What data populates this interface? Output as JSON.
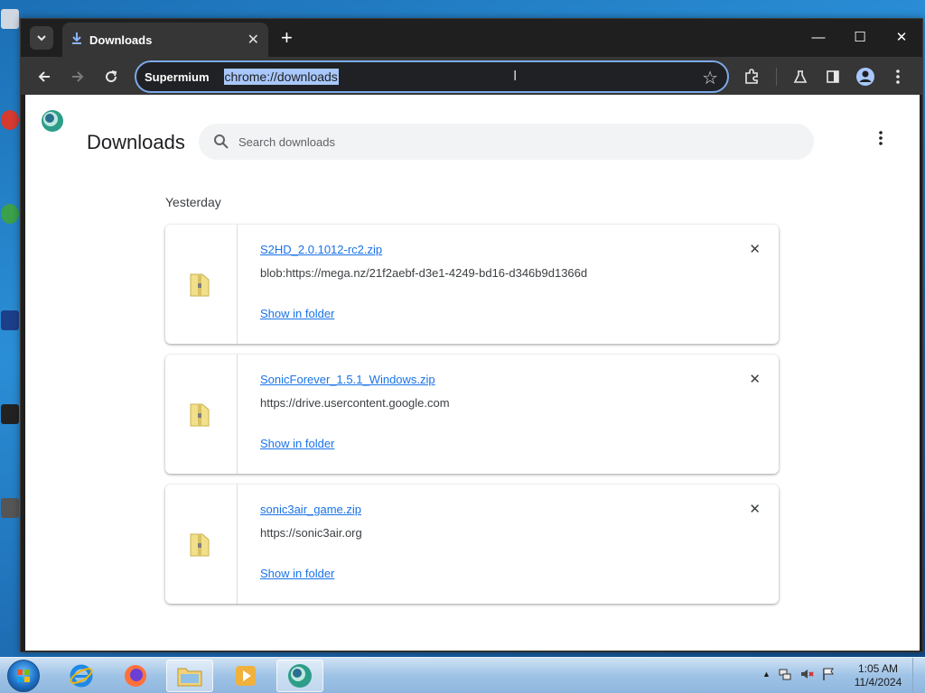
{
  "browser": {
    "tab": {
      "title": "Downloads"
    },
    "omnibox": {
      "brand": "Supermium",
      "url": "chrome://downloads"
    }
  },
  "page": {
    "title": "Downloads",
    "search": {
      "placeholder": "Search downloads",
      "value": ""
    },
    "date_heading": "Yesterday",
    "downloads": [
      {
        "file_name": "S2HD_2.0.1012-rc2.zip",
        "source_url": "blob:https://mega.nz/21f2aebf-d3e1-4249-bd16-d346b9d1366d",
        "action_label": "Show in folder"
      },
      {
        "file_name": "SonicForever_1.5.1_Windows.zip",
        "source_url": "https://drive.usercontent.google.com",
        "action_label": "Show in folder"
      },
      {
        "file_name": "sonic3air_game.zip",
        "source_url": "https://sonic3air.org",
        "action_label": "Show in folder"
      }
    ]
  },
  "taskbar": {
    "clock": {
      "time": "1:05 AM",
      "date": "11/4/2024"
    }
  },
  "colors": {
    "accent": "#1a73e8",
    "omnibox_border": "#7ca9e8",
    "selection": "#a8c7fa",
    "titlebar": "#1f1f1f",
    "toolbar": "#363636"
  }
}
